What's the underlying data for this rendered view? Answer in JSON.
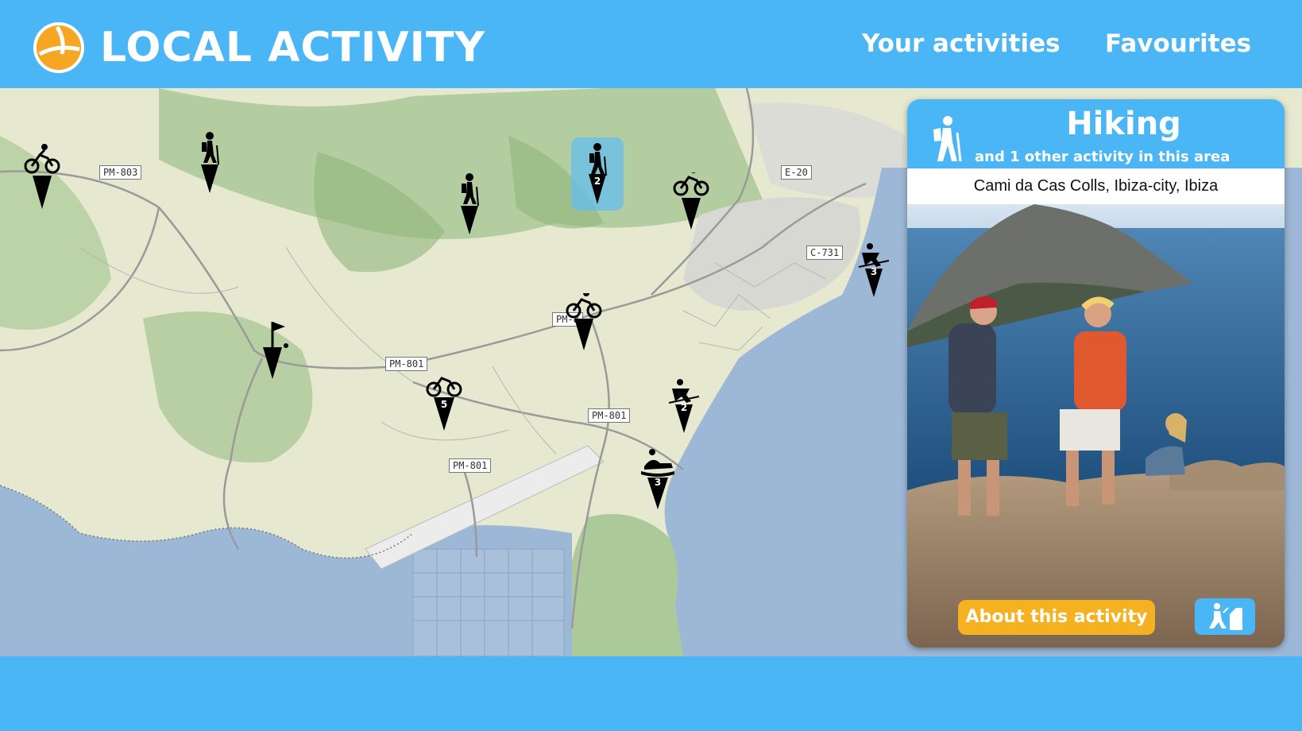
{
  "app": {
    "title": "LOCAL ACTIVITY",
    "logo_icon": "sun-logo-icon"
  },
  "nav": {
    "your_activities": "Your activities",
    "favourites": "Favourites"
  },
  "colors": {
    "primary": "#4ab6f5",
    "accent": "#f5b120",
    "marker": "#111111"
  },
  "map": {
    "road_labels": [
      "PM-803",
      "E-20",
      "C-731",
      "PM-8",
      "PM-801",
      "PM-801",
      "PM-801"
    ],
    "markers": [
      {
        "icon": "cycling-icon",
        "count": ""
      },
      {
        "icon": "hiking-icon",
        "count": ""
      },
      {
        "icon": "hiking-icon",
        "count": ""
      },
      {
        "icon": "hiking-icon",
        "count": "2"
      },
      {
        "icon": "cycling-icon",
        "count": ""
      },
      {
        "icon": "surfing-icon",
        "count": "3"
      },
      {
        "icon": "cycling-icon",
        "count": ""
      },
      {
        "icon": "golf-icon",
        "count": ""
      },
      {
        "icon": "cycling-icon",
        "count": "5"
      },
      {
        "icon": "surfing-icon",
        "count": "2"
      },
      {
        "icon": "rafting-icon",
        "count": "3"
      }
    ]
  },
  "card": {
    "title": "Hiking",
    "subtitle": "and 1 other activity in this area",
    "address": "Cami da Cas Colls, Ibiza-city, Ibiza",
    "icon": "hiking-icon",
    "button": "About this activity",
    "badge_icon": "climbing-icon"
  }
}
